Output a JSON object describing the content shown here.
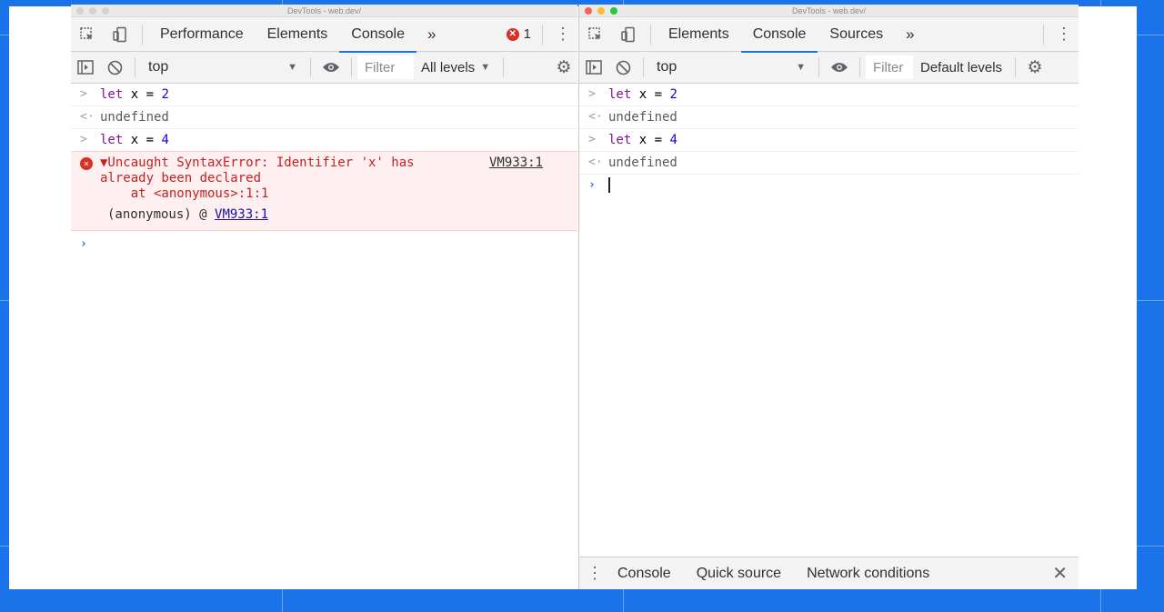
{
  "left_window": {
    "title": "DevTools - web.dev/",
    "tabs": [
      "Performance",
      "Elements",
      "Console"
    ],
    "more_tabs": "»",
    "error_count": "1",
    "context": "top",
    "filter_placeholder": "Filter",
    "levels": "All levels",
    "entries": {
      "cmd1_kw": "let",
      "cmd1_rest": " x = ",
      "cmd1_num": "2",
      "ret1": "undefined",
      "cmd2_kw": "let",
      "cmd2_rest": " x = ",
      "cmd2_num": "4"
    },
    "error": {
      "message": "▼Uncaught SyntaxError: Identifier 'x' has\nalready been declared\n    at <anonymous>:1:1",
      "source": "VM933:1",
      "stack_prefix": "(anonymous) @ ",
      "stack_link": "VM933:1"
    }
  },
  "right_window": {
    "title": "DevTools - web.dev/",
    "tabs": [
      "Elements",
      "Console",
      "Sources"
    ],
    "more_tabs": "»",
    "context": "top",
    "filter_placeholder": "Filter",
    "levels": "Default levels",
    "entries": {
      "cmd1_kw": "let",
      "cmd1_rest": " x = ",
      "cmd1_num": "2",
      "ret1": "undefined",
      "cmd2_kw": "let",
      "cmd2_rest": " x = ",
      "cmd2_num": "4",
      "ret2": "undefined"
    },
    "drawer_tabs": [
      "Console",
      "Quick source",
      "Network conditions"
    ],
    "drawer_close": "✕"
  },
  "glyphs": {
    "input_marker": ">",
    "return_marker": "<·",
    "prompt": "›"
  },
  "colors": {
    "accent": "#1a73e8",
    "error": "#d93025",
    "error_bg": "#fef0f0"
  }
}
